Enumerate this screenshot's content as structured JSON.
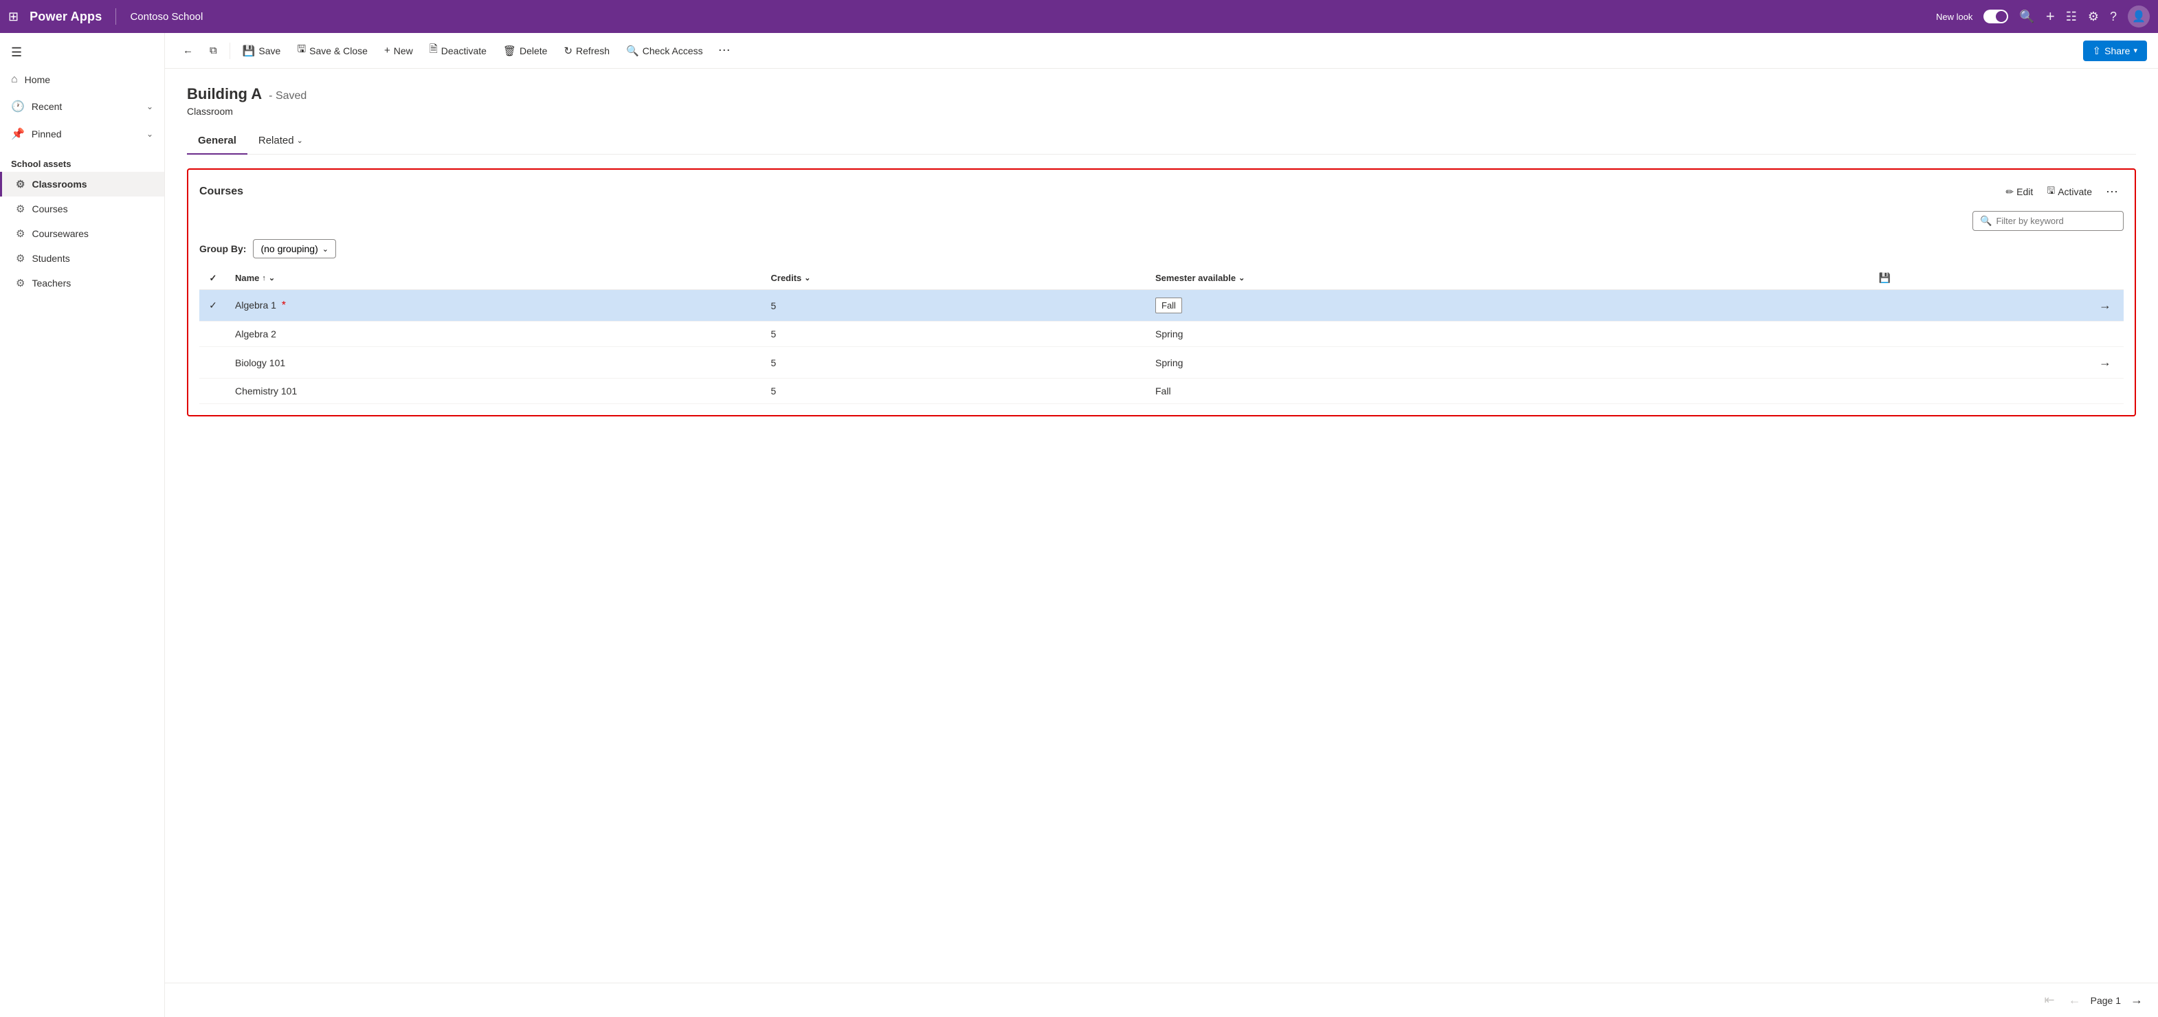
{
  "topNav": {
    "waffle": "⊞",
    "appTitle": "Power Apps",
    "envName": "Contoso School",
    "newLookLabel": "New look",
    "icons": {
      "search": "🔍",
      "add": "+",
      "filter": "⧩",
      "settings": "⚙",
      "help": "?",
      "avatar": "👤"
    }
  },
  "sidebar": {
    "menuIcon": "☰",
    "items": [
      {
        "id": "home",
        "label": "Home",
        "icon": "⌂"
      },
      {
        "id": "recent",
        "label": "Recent",
        "icon": "🕐",
        "hasChevron": true
      },
      {
        "id": "pinned",
        "label": "Pinned",
        "icon": "📌",
        "hasChevron": true
      }
    ],
    "sectionTitle": "School assets",
    "navItems": [
      {
        "id": "classrooms",
        "label": "Classrooms",
        "icon": "⚙",
        "active": true
      },
      {
        "id": "courses",
        "label": "Courses",
        "icon": "⚙"
      },
      {
        "id": "coursewares",
        "label": "Coursewares",
        "icon": "⚙"
      },
      {
        "id": "students",
        "label": "Students",
        "icon": "⚙"
      },
      {
        "id": "teachers",
        "label": "Teachers",
        "icon": "⚙"
      }
    ]
  },
  "toolbar": {
    "back": "←",
    "popout": "⬡",
    "save": "Save",
    "saveClose": "Save & Close",
    "new": "New",
    "deactivate": "Deactivate",
    "delete": "Delete",
    "refresh": "Refresh",
    "checkAccess": "Check Access",
    "more": "⋯",
    "share": "Share"
  },
  "record": {
    "title": "Building A",
    "savedLabel": "- Saved",
    "subtitle": "Classroom",
    "tabs": [
      {
        "id": "general",
        "label": "General",
        "active": true
      },
      {
        "id": "related",
        "label": "Related",
        "hasChevron": true
      }
    ]
  },
  "coursesSection": {
    "title": "Courses",
    "editLabel": "Edit",
    "activateLabel": "Activate",
    "filterPlaceholder": "Filter by keyword",
    "groupByLabel": "Group By:",
    "groupByValue": "(no grouping)",
    "columns": [
      {
        "id": "name",
        "label": "Name",
        "sortDir": "asc"
      },
      {
        "id": "credits",
        "label": "Credits",
        "sortDir": "desc"
      },
      {
        "id": "semester",
        "label": "Semester available",
        "sortDir": "none"
      }
    ],
    "rows": [
      {
        "id": 1,
        "checked": true,
        "name": "Algebra 1",
        "hasRedStar": true,
        "credits": 5,
        "semester": "Fall",
        "semesterEditing": true,
        "selected": true
      },
      {
        "id": 2,
        "checked": false,
        "name": "Algebra 2",
        "hasRedStar": false,
        "credits": 5,
        "semester": "Spring",
        "semesterEditing": false,
        "selected": false
      },
      {
        "id": 3,
        "checked": false,
        "name": "Biology 101",
        "hasRedStar": false,
        "credits": 5,
        "semester": "Spring",
        "semesterEditing": false,
        "selected": false,
        "hasArrow": true
      },
      {
        "id": 4,
        "checked": false,
        "name": "Chemistry 101",
        "hasRedStar": false,
        "credits": 5,
        "semester": "Fall",
        "semesterEditing": false,
        "selected": false
      }
    ],
    "pagination": {
      "pageLabel": "Page 1",
      "prevDisabled": true
    }
  }
}
